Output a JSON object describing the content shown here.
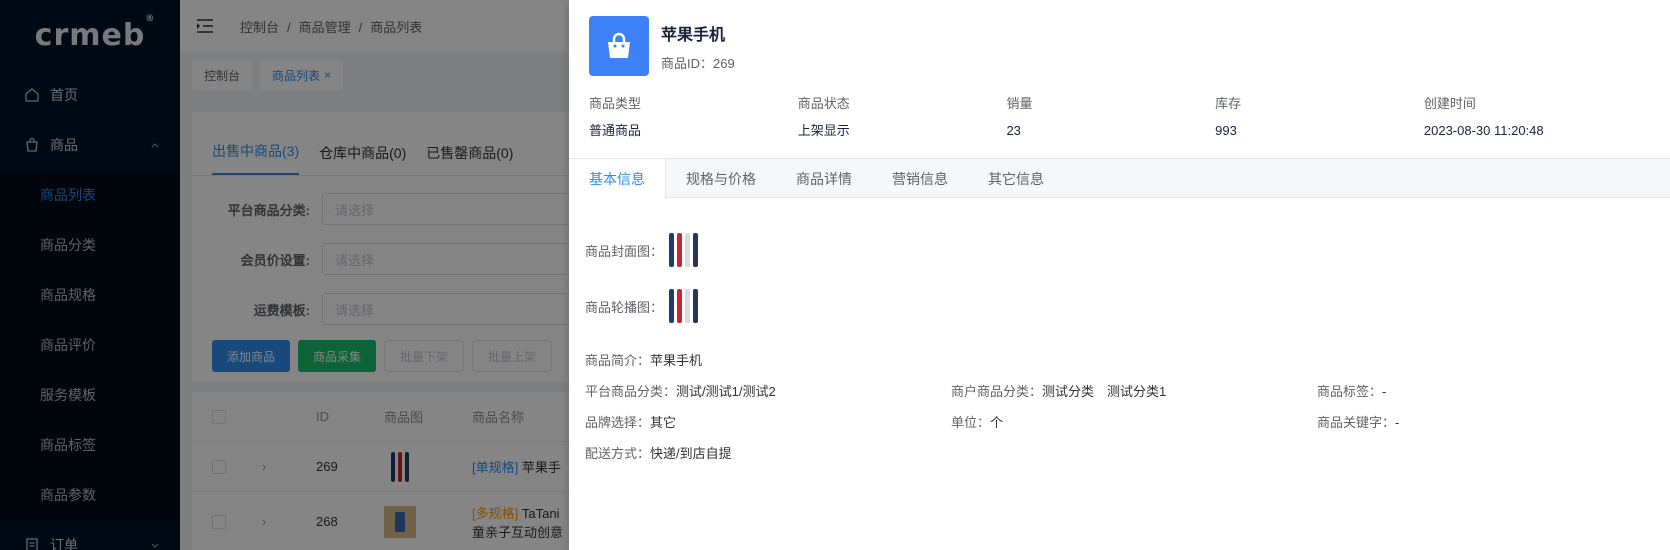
{
  "logo": {
    "text": "crmeb",
    "mark": "®"
  },
  "sidebar": {
    "home": "首页",
    "product_group": "商品",
    "items": [
      "商品列表",
      "商品分类",
      "商品规格",
      "商品评价",
      "服务模板",
      "商品标签",
      "商品参数"
    ],
    "order_group": "订单"
  },
  "topbar": {
    "breadcrumb": [
      "控制台",
      "商品管理",
      "商品列表"
    ],
    "separator": "/"
  },
  "tagsbar": {
    "tags": [
      "控制台",
      "商品列表"
    ],
    "close_glyph": "×"
  },
  "list_page": {
    "tabs": [
      "出售中商品(3)",
      "仓库中商品(0)",
      "已售罄商品(0)"
    ],
    "filters": [
      {
        "label": "平台商品分类:",
        "placeholder": "请选择"
      },
      {
        "label": "会员价设置:",
        "placeholder": "请选择"
      },
      {
        "label": "运费模板:",
        "placeholder": "请选择"
      }
    ],
    "buttons": {
      "add": "添加商品",
      "collect": "商品采集",
      "batch_off": "批量下架",
      "batch_on": "批量上架"
    },
    "table": {
      "headers": {
        "id": "ID",
        "image": "商品图",
        "name": "商品名称"
      },
      "rows": [
        {
          "id": "269",
          "tag": "[单规格]",
          "name": "苹果手",
          "expand": "›"
        },
        {
          "id": "268",
          "tag": "[多规格]",
          "name": "TaTani",
          "name2": "童亲子互动创意",
          "expand": "›"
        }
      ]
    }
  },
  "drawer": {
    "title": "苹果手机",
    "product_id": "商品ID：269",
    "info": [
      {
        "label": "商品类型",
        "value": "普通商品"
      },
      {
        "label": "商品状态",
        "value": "上架显示"
      },
      {
        "label": "销量",
        "value": "23"
      },
      {
        "label": "库存",
        "value": "993"
      },
      {
        "label": "创建时间",
        "value": "2023-08-30 11:20:48"
      }
    ],
    "tabs": [
      "基本信息",
      "规格与价格",
      "商品详情",
      "营销信息",
      "其它信息"
    ],
    "basic": {
      "cover_label": "商品封面图：",
      "carousel_label": "商品轮播图：",
      "intro_label": "商品简介：",
      "intro_value": "苹果手机",
      "platform_cat_label": "平台商品分类：",
      "platform_cat_value": "测试/测试1/测试2",
      "merchant_cat_label": "商户商品分类：",
      "merchant_cat_value": "测试分类　测试分类1",
      "tag_label": "商品标签：",
      "tag_value": "-",
      "brand_label": "品牌选择：",
      "brand_value": "其它",
      "unit_label": "单位：",
      "unit_value": "个",
      "keyword_label": "商品关键字：",
      "keyword_value": "-",
      "delivery_label": "配送方式：",
      "delivery_value": "快递/到店自提"
    }
  },
  "colors": {
    "primary": "#2d8cf0",
    "success": "#19be6b",
    "sidebar_bg": "#001529",
    "avatar_bg": "#3c82f6"
  }
}
